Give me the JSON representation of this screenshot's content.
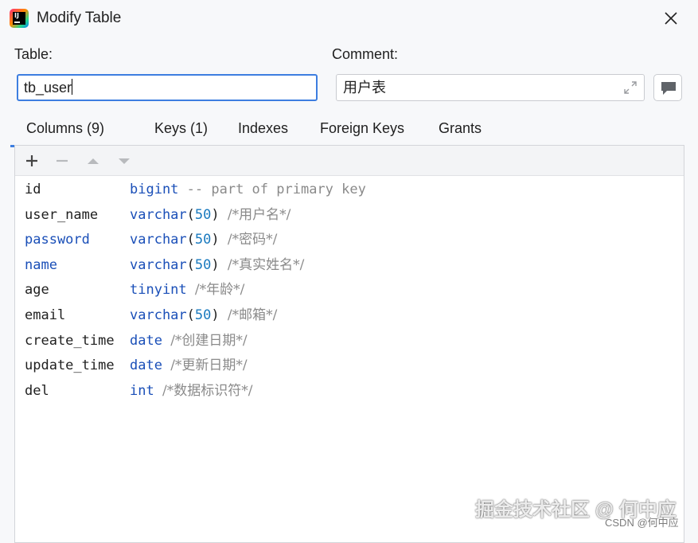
{
  "window": {
    "title": "Modify Table",
    "app_icon_text": "IJ"
  },
  "form": {
    "table_label": "Table:",
    "table_value": "tb_user",
    "comment_label": "Comment:",
    "comment_value": "用户表"
  },
  "tabs": [
    {
      "label": "Columns (9)",
      "active": true
    },
    {
      "label": "Keys (1)",
      "active": false
    },
    {
      "label": "Indexes",
      "active": false
    },
    {
      "label": "Foreign Keys",
      "active": false
    },
    {
      "label": "Grants",
      "active": false
    }
  ],
  "toolbar": {
    "icons": [
      "plus-icon",
      "minus-icon",
      "move-up-icon",
      "move-down-icon"
    ]
  },
  "columns": [
    {
      "name": "id",
      "name_keyword": false,
      "type": "bigint",
      "size": "",
      "comment": "-- part of primary key",
      "comment_cn": false
    },
    {
      "name": "user_name",
      "name_keyword": false,
      "type": "varchar",
      "size": "50",
      "comment": "/*用户名*/",
      "comment_cn": true
    },
    {
      "name": "password",
      "name_keyword": true,
      "type": "varchar",
      "size": "50",
      "comment": "/*密码*/",
      "comment_cn": true
    },
    {
      "name": "name",
      "name_keyword": true,
      "type": "varchar",
      "size": "50",
      "comment": "/*真实姓名*/",
      "comment_cn": true
    },
    {
      "name": "age",
      "name_keyword": false,
      "type": "tinyint",
      "size": "",
      "comment": "/*年龄*/",
      "comment_cn": true
    },
    {
      "name": "email",
      "name_keyword": false,
      "type": "varchar",
      "size": "50",
      "comment": "/*邮箱*/",
      "comment_cn": true
    },
    {
      "name": "create_time",
      "name_keyword": false,
      "type": "date",
      "size": "",
      "comment": "/*创建日期*/",
      "comment_cn": true
    },
    {
      "name": "update_time",
      "name_keyword": false,
      "type": "date",
      "size": "",
      "comment": "/*更新日期*/",
      "comment_cn": true
    },
    {
      "name": "del",
      "name_keyword": false,
      "type": "int",
      "size": "",
      "comment": "/*数据标识符*/",
      "comment_cn": true
    }
  ],
  "watermark": {
    "main": "掘金技术社区 @ 何中应",
    "small": "CSDN @何中应"
  },
  "colors": {
    "accent": "#3d7ee0",
    "keyword": "#1a4fb8",
    "number": "#1a7abf",
    "comment": "#8a8a8a"
  }
}
